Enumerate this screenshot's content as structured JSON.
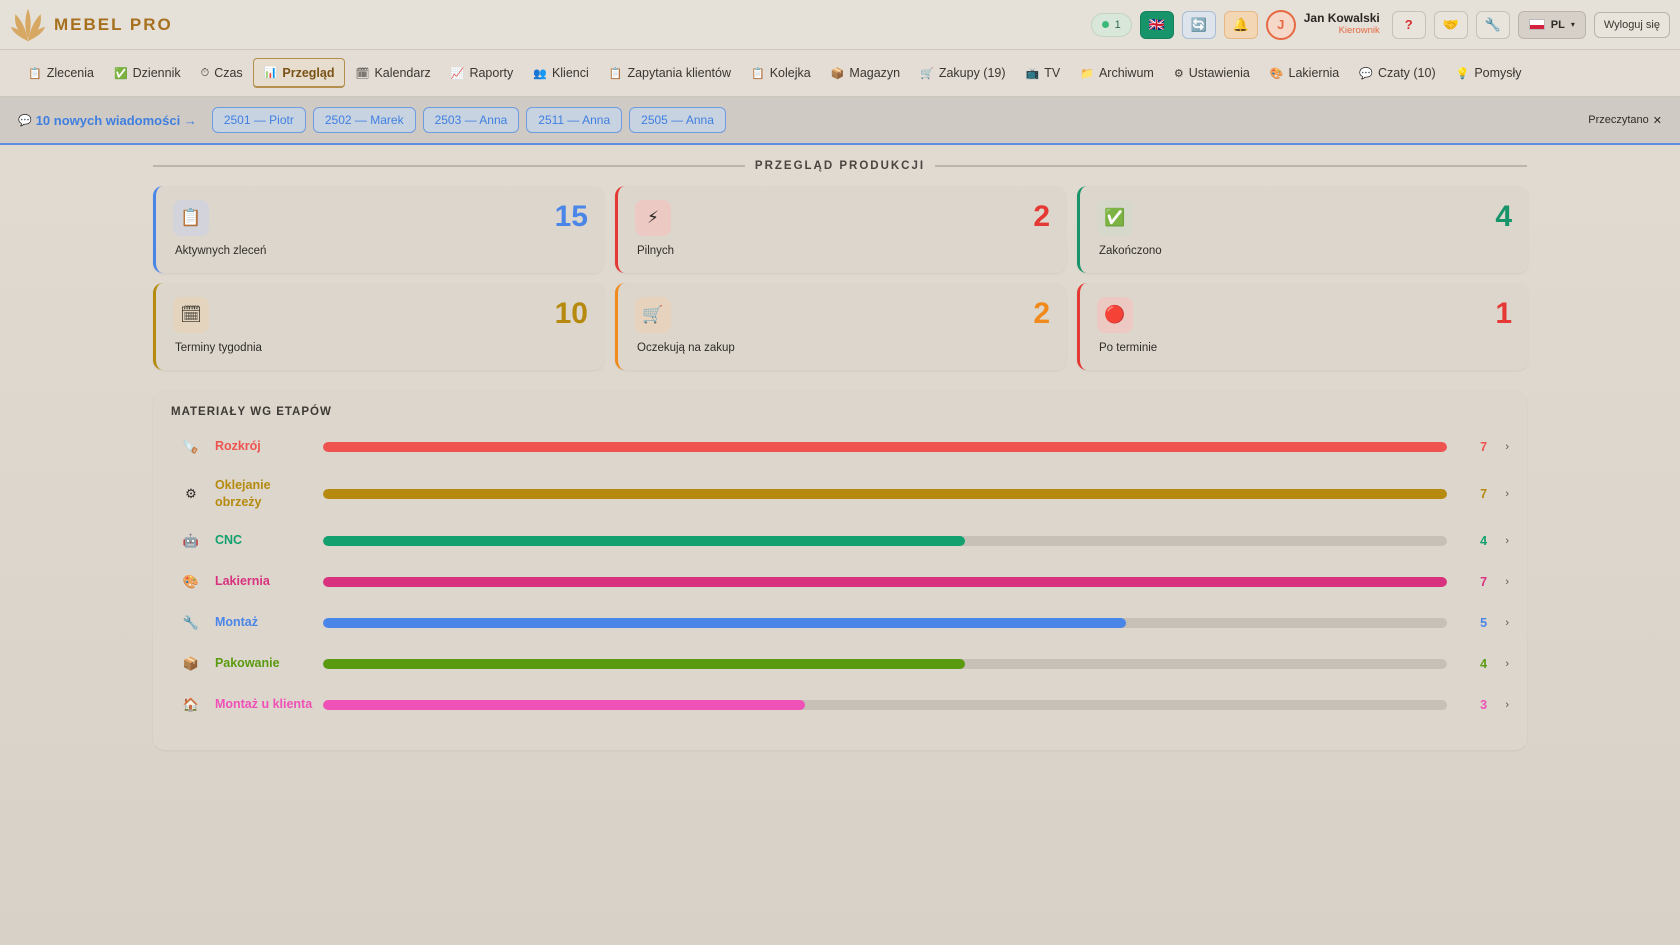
{
  "header": {
    "logo_text": "MEBEL PRO",
    "online_count": "1",
    "user_initial": "J",
    "user_name": "Jan Kowalski",
    "user_role": "Kierownik",
    "help_label": "?",
    "lang_label": "PL",
    "logout_label": "Wyloguj się"
  },
  "nav": {
    "items": [
      {
        "label": "Zlecenia",
        "icon": "📋"
      },
      {
        "label": "Dziennik",
        "icon": "✅"
      },
      {
        "label": "Czas",
        "icon": "⏱"
      },
      {
        "label": "Przegląd",
        "icon": "📊"
      },
      {
        "label": "Kalendarz",
        "icon": "🗓"
      },
      {
        "label": "Raporty",
        "icon": "📈"
      },
      {
        "label": "Klienci",
        "icon": "👥"
      },
      {
        "label": "Zapytania klientów",
        "icon": "📋"
      },
      {
        "label": "Kolejka",
        "icon": "📋"
      },
      {
        "label": "Magazyn",
        "icon": "📦"
      },
      {
        "label": "Zakupy (19)",
        "icon": "🛒"
      },
      {
        "label": "TV",
        "icon": "📺"
      },
      {
        "label": "Archiwum",
        "icon": "📁"
      },
      {
        "label": "Ustawienia",
        "icon": "⚙"
      },
      {
        "label": "Lakiernia",
        "icon": "🎨"
      },
      {
        "label": "Czaty (10)",
        "icon": "💬"
      },
      {
        "label": "Pomysły",
        "icon": "💡"
      }
    ],
    "active": "Przegląd"
  },
  "notification": {
    "title": "10 nowych wiadomości →",
    "chips": [
      "2501 — Piotr",
      "2502 — Marek",
      "2503 — Anna",
      "2511 — Anna",
      "2505 — Anna"
    ],
    "mark_read": "Przeczytano",
    "close": "✕"
  },
  "overview": {
    "title": "PRZEGLĄD PRODUKCJI",
    "cards": [
      {
        "label": "Aktywnych zleceń",
        "value": "15",
        "color": "#4a86e8",
        "icon": "📋",
        "icon_bg": "#d3d3dc"
      },
      {
        "label": "Pilnych",
        "value": "2",
        "color": "#e53935",
        "icon": "⚡",
        "icon_bg": "#ecc9c2"
      },
      {
        "label": "Zakończono",
        "value": "4",
        "color": "#17946a",
        "icon": "✅",
        "icon_bg": "#d6d8cc"
      },
      {
        "label": "Terminy tygodnia",
        "value": "10",
        "color": "#b58a0e",
        "icon": "🗓",
        "icon_bg": "#e4d4bd"
      },
      {
        "label": "Oczekują na zakup",
        "value": "2",
        "color": "#f08a1c",
        "icon": "🛒",
        "icon_bg": "#e6d2bd"
      },
      {
        "label": "Po terminie",
        "value": "1",
        "color": "#e53935",
        "icon": "🔴",
        "icon_bg": "#ecc9c2"
      }
    ]
  },
  "materials": {
    "title": "MATERIAŁY WG ETAPÓW",
    "max": 7,
    "stages": [
      {
        "name": "Rozkrój",
        "count": 7,
        "color": "#ef5350",
        "icon": "🪚"
      },
      {
        "name": "Oklejanie obrzeży",
        "count": 7,
        "color": "#b58a0e",
        "icon": "⚙"
      },
      {
        "name": "CNC",
        "count": 4,
        "color": "#12a06e",
        "icon": "🤖"
      },
      {
        "name": "Lakiernia",
        "count": 7,
        "color": "#d8327e",
        "icon": "🎨"
      },
      {
        "name": "Montaż",
        "count": 5,
        "color": "#4a86e8",
        "icon": "🔧"
      },
      {
        "name": "Pakowanie",
        "count": 4,
        "color": "#5a9a0e",
        "icon": "📦"
      },
      {
        "name": "Montaż u klienta",
        "count": 3,
        "color": "#f051b7",
        "icon": "🏠"
      }
    ]
  }
}
